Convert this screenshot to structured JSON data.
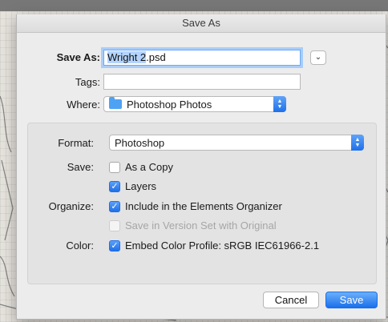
{
  "dialog": {
    "title": "Save As",
    "save_as": {
      "label": "Save As:",
      "value_selected": "Wright 2",
      "value_rest": ".psd"
    },
    "tags": {
      "label": "Tags:",
      "value": ""
    },
    "where": {
      "label": "Where:",
      "value": "Photoshop Photos",
      "icon": "folder-icon"
    },
    "options": {
      "format": {
        "label": "Format:",
        "value": "Photoshop"
      },
      "save": {
        "label": "Save:",
        "as_a_copy": {
          "text": "As a Copy",
          "checked": false
        },
        "layers": {
          "text": "Layers",
          "checked": true
        }
      },
      "organize": {
        "label": "Organize:",
        "include_organizer": {
          "text": "Include in the Elements Organizer",
          "checked": true
        },
        "version_set": {
          "text": "Save in Version Set with Original",
          "checked": false,
          "disabled": true
        }
      },
      "color": {
        "label": "Color:",
        "embed_profile": {
          "text": "Embed Color Profile:  sRGB IEC61966-2.1",
          "checked": true
        }
      }
    },
    "buttons": {
      "cancel": "Cancel",
      "save": "Save"
    }
  },
  "colors": {
    "accent": "#1f70e8",
    "focus_ring": "#a9cdf9",
    "selection": "#b4d4fd"
  }
}
